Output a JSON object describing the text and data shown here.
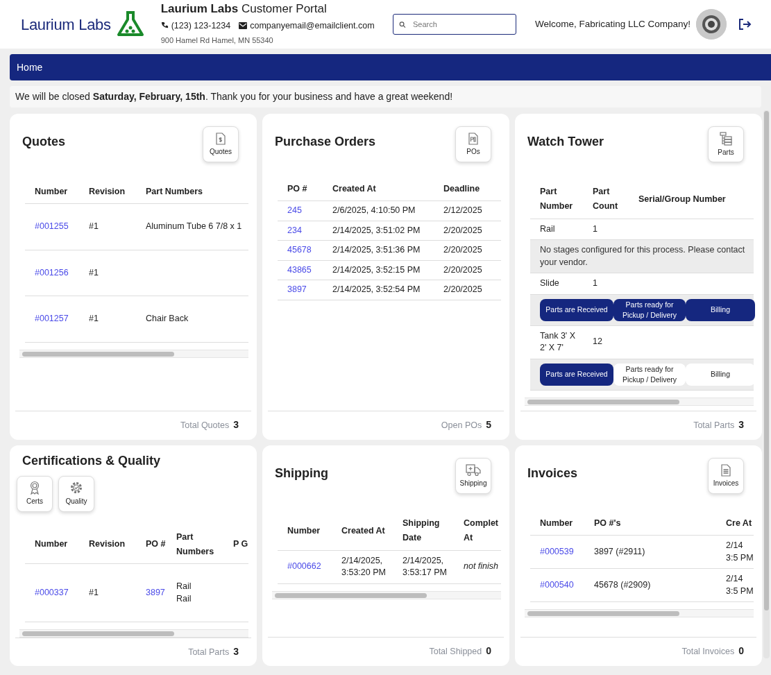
{
  "header": {
    "logo_text": "Laurium Labs",
    "title": "**Laurium Labs** Customer Portal",
    "phone": "(123) 123-1234",
    "email": "companyemail@emailclient.com",
    "address": "900 Hamel Rd Hamel, MN 55340",
    "search": {
      "placeholder": "Search"
    },
    "welcome": "Welcome, Fabricating LLC Company!"
  },
  "nav": {
    "items": [
      {
        "label": "Home"
      }
    ]
  },
  "notice": "We will be closed **Saturday, February, 15th**. Thank you for your business and have a great weekend!",
  "cards": [
    {
      "kind": "table",
      "title": "Quotes",
      "buttons": [
        {
          "label": "Quotes"
        }
      ],
      "horizontal_scroll": true,
      "columns": [
        {
          "label": "Number",
          "kind": "link"
        },
        {
          "label": "Revision",
          "kind": "text"
        },
        {
          "label": "Part Numbers",
          "kind": "text"
        }
      ],
      "rows": [
        [
          "#001255",
          "#1",
          "Aluminum Tube 6 7/8 x 1"
        ],
        [
          "#001256",
          "#1"
        ],
        [
          "#001257",
          "#1",
          "Chair Back"
        ]
      ],
      "footer": {
        "label": "Total Quotes",
        "value": "3"
      }
    },
    {
      "kind": "table",
      "title": "Purchase Orders",
      "buttons": [
        {
          "label": "POs"
        }
      ],
      "horizontal_scroll": false,
      "columns": [
        {
          "label": "PO #",
          "kind": "link"
        },
        {
          "label": "Created At",
          "kind": "text"
        },
        {
          "label": "Deadline",
          "kind": "text"
        }
      ],
      "rows": [
        [
          "245",
          "2/6/2025, 4:10:50 PM",
          "2/12/2025"
        ],
        [
          "234",
          "2/14/2025, 3:51:02 PM",
          "2/20/2025"
        ],
        [
          "45678",
          "2/14/2025, 3:51:36 PM",
          "2/20/2025"
        ],
        [
          "43865",
          "2/14/2025, 3:52:15 PM",
          "2/20/2025"
        ],
        [
          "3897",
          "2/14/2025, 3:52:54 PM",
          "2/20/2025"
        ]
      ],
      "footer": {
        "label": "Open POs",
        "value": "5"
      }
    },
    {
      "kind": "tracker",
      "title": "Watch Tower",
      "buttons": [
        {
          "label": "Parts"
        }
      ],
      "horizontal_scroll": true,
      "columns": [
        {
          "label": "Part Number"
        },
        {
          "label": "Part Count"
        },
        {
          "label": "Serial/Group Number"
        }
      ],
      "rows": [
        {
          "kind": "part",
          "cells": [
            "Rail",
            "1"
          ]
        },
        {
          "kind": "message",
          "text": "No stages configured for this process. Please contact your vendor."
        },
        {
          "kind": "part",
          "cells": [
            "Slide",
            "1"
          ]
        },
        {
          "kind": "stages",
          "stages": [
            {
              "label": "Parts are Received",
              "done": true
            },
            {
              "label": "Parts ready for Pickup / Delivery",
              "done": true
            },
            {
              "label": "Billing",
              "done": true
            }
          ]
        },
        {
          "kind": "part",
          "cells": [
            "Tank 3' X 2' X 7'",
            "12"
          ]
        },
        {
          "kind": "stages",
          "stages": [
            {
              "label": "Parts are Received",
              "done": true
            },
            {
              "label": "Parts ready for Pickup / Delivery",
              "done": false
            },
            {
              "label": "Billing",
              "done": false
            }
          ]
        }
      ],
      "footer": {
        "label": "Total Parts",
        "value": "3"
      }
    },
    {
      "kind": "toolbar-table",
      "title": "Certifications & Quality",
      "buttons": [
        {
          "label": "Certs"
        },
        {
          "label": "Quality"
        }
      ],
      "horizontal_scroll": true,
      "columns": [
        {
          "label": "Number",
          "kind": "link"
        },
        {
          "label": "Revision",
          "kind": "text"
        },
        {
          "label": "PO #",
          "kind": "link"
        },
        {
          "label": "Part Numbers",
          "kind": "lines"
        },
        {
          "label": "P G"
        }
      ],
      "rows": [
        [
          "#000337",
          "#1",
          "3897",
          "Rail\nRail"
        ]
      ],
      "footer": {
        "label": "Total Parts",
        "value": "3"
      }
    },
    {
      "kind": "table",
      "title": "Shipping",
      "buttons": [
        {
          "label": "Shipping"
        }
      ],
      "horizontal_scroll": true,
      "columns": [
        {
          "label": "Number",
          "kind": "link"
        },
        {
          "label": "Created At",
          "kind": "text"
        },
        {
          "label": "Shipping Date",
          "kind": "text"
        },
        {
          "label": "Complet At",
          "kind": "italic"
        }
      ],
      "rows": [
        [
          "#000662",
          "2/14/2025, 3:53:20 PM",
          "2/14/2025, 3:53:17 PM",
          "not finish"
        ]
      ],
      "footer": {
        "label": "Total Shipped",
        "value": "0"
      }
    },
    {
      "kind": "table",
      "title": "Invoices",
      "buttons": [
        {
          "label": "Invoices"
        }
      ],
      "horizontal_scroll": true,
      "columns": [
        {
          "label": "Number",
          "kind": "link"
        },
        {
          "label": "PO #'s",
          "kind": "text"
        },
        {
          "label": "Cre At",
          "kind": "text"
        }
      ],
      "rows": [
        [
          "#000539",
          "3897 (#2911)",
          "2/14 3:5 PM"
        ],
        [
          "#000540",
          "45678 (#2909)",
          "2/14 3:5 PM"
        ]
      ],
      "footer": {
        "label": "Total Invoices",
        "value": "0"
      }
    }
  ]
}
